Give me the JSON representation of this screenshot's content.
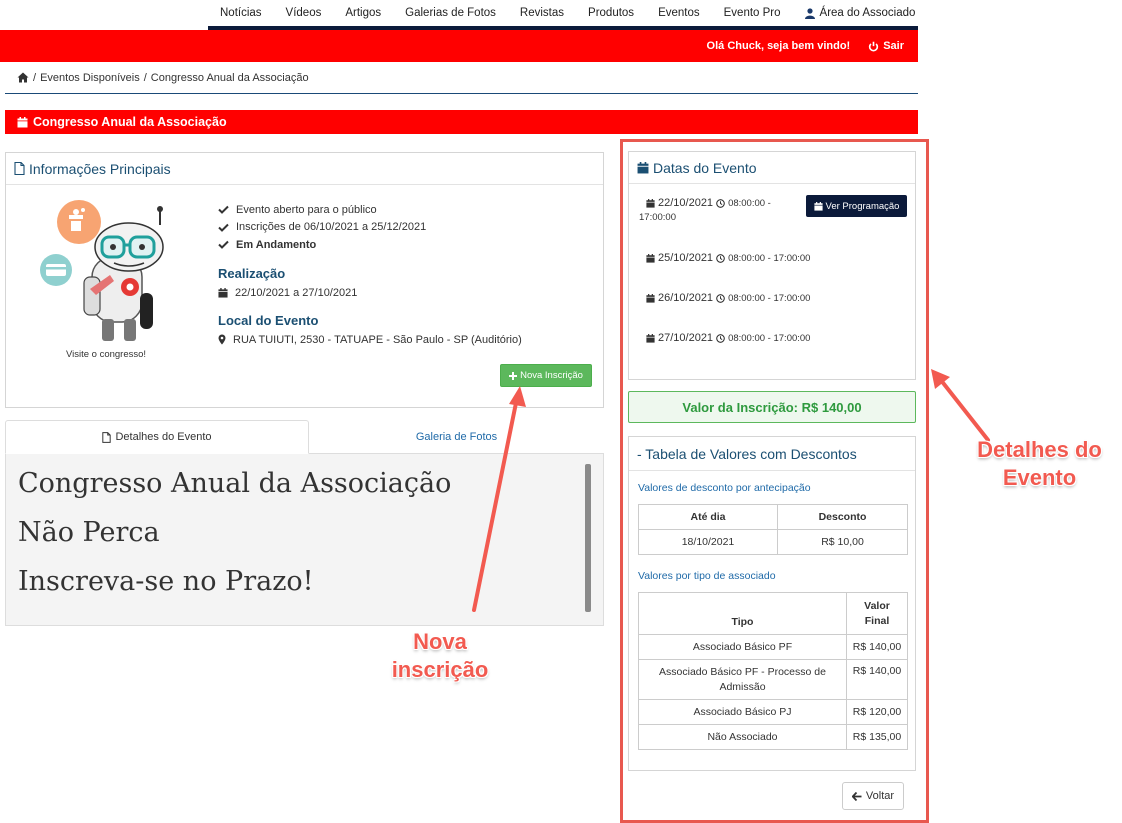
{
  "topnav": {
    "items": [
      "Notícias",
      "Vídeos",
      "Artigos",
      "Galerias de Fotos",
      "Revistas",
      "Produtos",
      "Eventos",
      "Evento Pro"
    ],
    "associado_label": "Área do Associado"
  },
  "userbar": {
    "welcome": "Olá Chuck, seja bem vindo!",
    "logout": "Sair"
  },
  "breadcrumb": {
    "sep": "/",
    "item1": "Eventos Disponíveis",
    "item2": "Congresso Anual da Associação"
  },
  "page_title": "Congresso Anual da Associação",
  "info": {
    "heading": "Informações Principais",
    "image_caption": "Visite o congresso!",
    "checks": [
      "Evento aberto para o público",
      "Inscrições de 06/10/2021 a 25/12/2021",
      "Em Andamento"
    ],
    "realizacao_title": "Realização",
    "realizacao_dates": "22/10/2021 a 27/10/2021",
    "local_title": "Local do Evento",
    "local_address": "RUA TUIUTI, 2530 - TATUAPE - São Paulo - SP (Auditório)",
    "nova_inscricao": "Nova Inscrição"
  },
  "tabs": {
    "detalhes": "Detalhes do Evento",
    "galeria": "Galeria de Fotos"
  },
  "content": {
    "line1": "Congresso Anual da Associação",
    "line2": "Não Perca",
    "line3": "Inscreva-se no Prazo!"
  },
  "datas": {
    "heading": "Datas do Evento",
    "ver_programacao": "Ver Programação",
    "rows": [
      {
        "date": "22/10/2021",
        "time_start": "08:00:00 -",
        "time_end": "17:00:00"
      },
      {
        "date": "25/10/2021",
        "time": "08:00:00 - 17:00:00"
      },
      {
        "date": "26/10/2021",
        "time": "08:00:00 - 17:00:00"
      },
      {
        "date": "27/10/2021",
        "time": "08:00:00 - 17:00:00"
      }
    ]
  },
  "valor_inscricao": "Valor da Inscrição: R$ 140,00",
  "tabela": {
    "heading": "- Tabela de Valores com Descontos",
    "antecipacao_label": "Valores de desconto por antecipação",
    "antecipacao_headers": [
      "Até dia",
      "Desconto"
    ],
    "antecipacao_rows": [
      [
        "18/10/2021",
        "R$ 10,00"
      ]
    ],
    "tipo_label": "Valores por tipo de associado",
    "tipo_headers": [
      "Tipo",
      "Valor Final"
    ],
    "tipo_rows": [
      [
        "Associado Básico PF",
        "R$ 140,00"
      ],
      [
        "Associado Básico PF - Processo de Admissão",
        "R$ 140,00"
      ],
      [
        "Associado Básico PJ",
        "R$ 120,00"
      ],
      [
        "Não Associado",
        "R$ 135,00"
      ]
    ]
  },
  "voltar": "Voltar",
  "annotations": {
    "nova": "Nova inscrição",
    "detalhes": "Detalhes do Evento"
  },
  "colors": {
    "red": "#ff0000",
    "navy": "#0b1a3a",
    "green": "#5cb85c",
    "heading_blue": "#1b4f72",
    "annotation": "#f25a50"
  }
}
